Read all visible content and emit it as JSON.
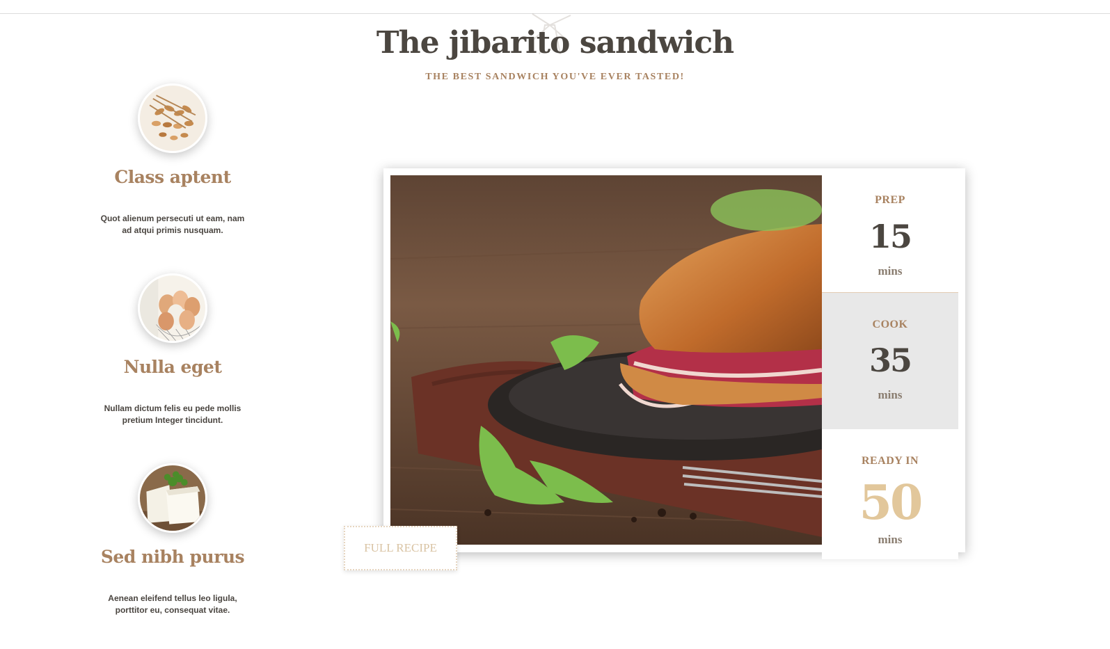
{
  "header": {
    "title": "The jibarito sandwich",
    "subtitle": "THE BEST SANDWICH YOU'VE EVER TASTED!"
  },
  "features": [
    {
      "title": "Class aptent",
      "text": "Quot alienum persecuti ut eam, nam ad atqui primis nusquam.",
      "image": "grains-icon"
    },
    {
      "title": "Nulla eget",
      "text": "Nullam dictum felis eu pede mollis pretium Integer tincidunt.",
      "image": "eggs-icon"
    },
    {
      "title": "Sed nibh purus",
      "text": "Aenean eleifend tellus leo ligula, porttitor eu, consequat vitae.",
      "image": "cheese-icon"
    }
  ],
  "recipe": {
    "button_label": "FULL RECIPE",
    "times": {
      "prep": {
        "label": "PREP",
        "value": "15",
        "unit": "mins"
      },
      "cook": {
        "label": "COOK",
        "value": "35",
        "unit": "mins"
      },
      "ready": {
        "label": "READY IN",
        "value": "50",
        "unit": "mins"
      }
    }
  },
  "colors": {
    "accent_brown": "#a88260",
    "dark_text": "#4b4640",
    "gold": "#e2c79b"
  }
}
